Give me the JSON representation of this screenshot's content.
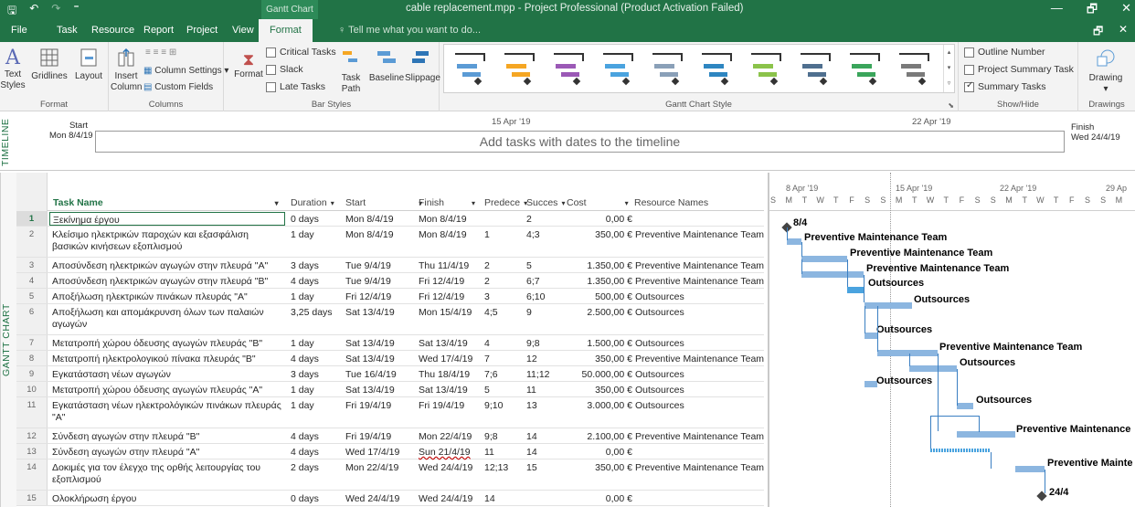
{
  "titlebar": {
    "context_tab": "Gantt Chart Tools",
    "title": "cable replacement.mpp - Project Professional (Product Activation Failed)",
    "qat_save": "🖫",
    "qat_undo": "↶",
    "qat_redo": "↷",
    "qat_more": "⁼",
    "win_minimize": "—",
    "win_restore": "🗗",
    "win_close": "✕"
  },
  "tabs": {
    "file": "File",
    "task": "Task",
    "resource": "Resource",
    "report": "Report",
    "project": "Project",
    "view": "View",
    "format": "Format",
    "tell_me": "Tell me what you want to do...",
    "restore": "🗗",
    "close": "✕"
  },
  "ribbon": {
    "format_group": {
      "text_styles": "Text Styles",
      "gridlines": "Gridlines",
      "layout": "Layout",
      "label": "Format"
    },
    "columns_group": {
      "insert_column": "Insert Column",
      "column_settings": "Column Settings",
      "custom_fields": "Custom Fields",
      "label": "Columns"
    },
    "bar_styles_group": {
      "format": "Format",
      "critical_tasks": "Critical Tasks",
      "slack": "Slack",
      "late_tasks": "Late Tasks",
      "task_path": "Task Path",
      "baseline": "Baseline",
      "slippage": "Slippage",
      "label": "Bar Styles"
    },
    "gantt_style_group": {
      "label": "Gantt Chart Style",
      "swatch_colors": [
        "#5b9bd5",
        "#f5a623",
        "#9b59b6",
        "#4aa3df",
        "#8aa0b8",
        "#2e86c1",
        "#8bc34a",
        "#4f6f8f",
        "#3aa55b",
        "#7a7a7a"
      ]
    },
    "show_hide_group": {
      "outline_number": "Outline Number",
      "project_summary_task": "Project Summary Task",
      "summary_tasks": "Summary Tasks",
      "summary_tasks_checked": true,
      "label": "Show/Hide"
    },
    "drawings_group": {
      "drawing": "Drawing",
      "label": "Drawings"
    }
  },
  "timeline": {
    "side_label": "TIMELINE",
    "start_label": "Start",
    "start_date": "Mon 8/4/19",
    "finish_label": "Finish",
    "finish_date": "Wed 24/4/19",
    "message": "Add tasks with dates to the timeline",
    "tick_1": "15 Apr '19",
    "tick_2": "22 Apr '19"
  },
  "table": {
    "side_label": "GANTT CHART",
    "columns": {
      "task_name": "Task Name",
      "duration": "Duration",
      "start": "Start",
      "finish": "Finish",
      "predecessors": "Predece",
      "successors": "Succes",
      "cost": "Cost",
      "resource_names": "Resource Names"
    },
    "rows": [
      {
        "id": "1",
        "name": "Ξεκίνημα έργου",
        "duration": "0 days",
        "start": "Mon 8/4/19",
        "finish": "Mon 8/4/19",
        "pred": "",
        "succ": "2",
        "cost": "0,00 €",
        "resource": ""
      },
      {
        "id": "2",
        "name": "Κλείσιμο ηλεκτρικών παροχών και εξασφάλιση βασικών κινήσεων εξοπλισμού",
        "duration": "1 day",
        "start": "Mon 8/4/19",
        "finish": "Mon 8/4/19",
        "pred": "1",
        "succ": "4;3",
        "cost": "350,00 €",
        "resource": "Preventive Maintenance Team"
      },
      {
        "id": "3",
        "name": "Αποσύνδεση ηλεκτρικών αγωγών στην πλευρά \"A\"",
        "duration": "3 days",
        "start": "Tue 9/4/19",
        "finish": "Thu 11/4/19",
        "pred": "2",
        "succ": "5",
        "cost": "1.350,00 €",
        "resource": "Preventive Maintenance Team"
      },
      {
        "id": "4",
        "name": "Αποσύνδεση ηλεκτρικών αγωγών στην πλευρά \"B\"",
        "duration": "4 days",
        "start": "Tue 9/4/19",
        "finish": "Fri 12/4/19",
        "pred": "2",
        "succ": "6;7",
        "cost": "1.350,00 €",
        "resource": "Preventive Maintenance Team"
      },
      {
        "id": "5",
        "name": "Αποξήλωση ηλεκτρικών πινάκων πλευράς \"A\"",
        "duration": "1 day",
        "start": "Fri 12/4/19",
        "finish": "Fri 12/4/19",
        "pred": "3",
        "succ": "6;10",
        "cost": "500,00 €",
        "resource": "Outsources"
      },
      {
        "id": "6",
        "name": "Αποξήλωση και απομάκρυνση όλων των παλαιών αγωγών",
        "duration": "3,25 days",
        "start": "Sat 13/4/19",
        "finish": "Mon 15/4/19",
        "pred": "4;5",
        "succ": "9",
        "cost": "2.500,00 €",
        "resource": "Outsources"
      },
      {
        "id": "7",
        "name": "Μετατροπή χώρου όδευσης αγωγών πλευράς \"B\"",
        "duration": "1 day",
        "start": "Sat 13/4/19",
        "finish": "Sat 13/4/19",
        "pred": "4",
        "succ": "9;8",
        "cost": "1.500,00 €",
        "resource": "Outsources"
      },
      {
        "id": "8",
        "name": "Μετατροπή ηλεκτρολογικού πίνακα πλευράς \"B\"",
        "duration": "4 days",
        "start": "Sat 13/4/19",
        "finish": "Wed 17/4/19",
        "pred": "7",
        "succ": "12",
        "cost": "350,00 €",
        "resource": "Preventive Maintenance Team"
      },
      {
        "id": "9",
        "name": "Εγκατάσταση νέων αγωγών",
        "duration": "3 days",
        "start": "Tue 16/4/19",
        "finish": "Thu 18/4/19",
        "pred": "7;6",
        "succ": "11;12",
        "cost": "50.000,00 €",
        "resource": "Outsources"
      },
      {
        "id": "10",
        "name": "Μετατροπή χώρου όδευσης αγωγών πλευράς \"A\"",
        "duration": "1 day",
        "start": "Sat 13/4/19",
        "finish": "Sat 13/4/19",
        "pred": "5",
        "succ": "11",
        "cost": "350,00 €",
        "resource": "Outsources"
      },
      {
        "id": "11",
        "name": "Εγκατάσταση νέων ηλεκτρολόγικών πινάκων πλευράς \"A\"",
        "duration": "1 day",
        "start": "Fri 19/4/19",
        "finish": "Fri 19/4/19",
        "pred": "9;10",
        "succ": "13",
        "cost": "3.000,00 €",
        "resource": "Outsources"
      },
      {
        "id": "12",
        "name": "Σύνδεση αγωγών στην πλευρά \"B\"",
        "duration": "4 days",
        "start": "Fri 19/4/19",
        "finish": "Mon 22/4/19",
        "pred": "9;8",
        "succ": "14",
        "cost": "2.100,00 €",
        "resource": "Preventive Maintenance Team"
      },
      {
        "id": "13",
        "name": "Σύνδεση αγωγών στην πλευρά \"A\"",
        "duration": "4 days",
        "start": "Wed 17/4/19",
        "finish": "Sun 21/4/19",
        "pred": "11",
        "succ": "14",
        "cost": "0,00 €",
        "resource": ""
      },
      {
        "id": "14",
        "name": "Δοκιμές για τον έλεγχο της ορθής λειτουργίας του εξοπλισμού",
        "duration": "2 days",
        "start": "Mon 22/4/19",
        "finish": "Wed 24/4/19",
        "pred": "12;13",
        "succ": "15",
        "cost": "350,00 €",
        "resource": "Preventive Maintenance Team"
      },
      {
        "id": "15",
        "name": "Ολοκλήρωση έργου",
        "duration": "0 days",
        "start": "Wed 24/4/19",
        "finish": "Wed 24/4/19",
        "pred": "14",
        "succ": "",
        "cost": "0,00 €",
        "resource": ""
      }
    ]
  },
  "gantt": {
    "weeks": [
      "8 Apr '19",
      "15 Apr '19",
      "22 Apr '19",
      "29 Ap"
    ],
    "day_letters": [
      "S",
      "M",
      "T",
      "W",
      "T",
      "F",
      "S",
      "S",
      "M",
      "T",
      "W",
      "T",
      "F",
      "S",
      "S",
      "M",
      "T",
      "W",
      "T",
      "F",
      "S",
      "S",
      "M"
    ],
    "bar_color": "#8cb6e0",
    "critical_color": "#4aa3df",
    "labels": {
      "start_milestone": "8/4",
      "end_milestone": "24/4",
      "pmt": "Preventive Maintenance Team",
      "pmt_trunc_1": "Preventive Maintenance",
      "pmt_trunc_2": "Preventive Mainte",
      "outsources": "Outsources"
    }
  }
}
